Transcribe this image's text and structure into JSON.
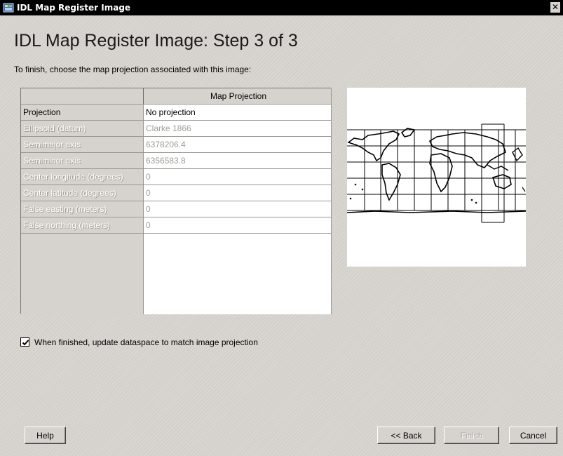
{
  "window": {
    "title": "IDL Map Register Image",
    "close_glyph": "✕"
  },
  "heading": "IDL Map Register Image: Step 3 of 3",
  "instruction": "To finish, choose the map projection associated with this image:",
  "grid": {
    "column_header": "Map Projection",
    "rows": [
      {
        "label": "Projection",
        "value": "No projection",
        "enabled": true
      },
      {
        "label": "Ellipsoid (datum)",
        "value": "Clarke 1866",
        "enabled": false
      },
      {
        "label": "Semimajor axis",
        "value": "6378206.4",
        "enabled": false
      },
      {
        "label": "Semiminor axis",
        "value": "6356583.8",
        "enabled": false
      },
      {
        "label": "Center longitude (degrees)",
        "value": "0",
        "enabled": false
      },
      {
        "label": "Center latitude (degrees)",
        "value": "0",
        "enabled": false
      },
      {
        "label": "False easting (meters)",
        "value": "0",
        "enabled": false
      },
      {
        "label": "False northing (meters)",
        "value": "0",
        "enabled": false
      }
    ]
  },
  "checkbox": {
    "label": "When finished, update dataspace to match image projection",
    "checked": true
  },
  "buttons": {
    "help": "Help",
    "back": "<< Back",
    "finish": "Finish",
    "cancel": "Cancel"
  }
}
